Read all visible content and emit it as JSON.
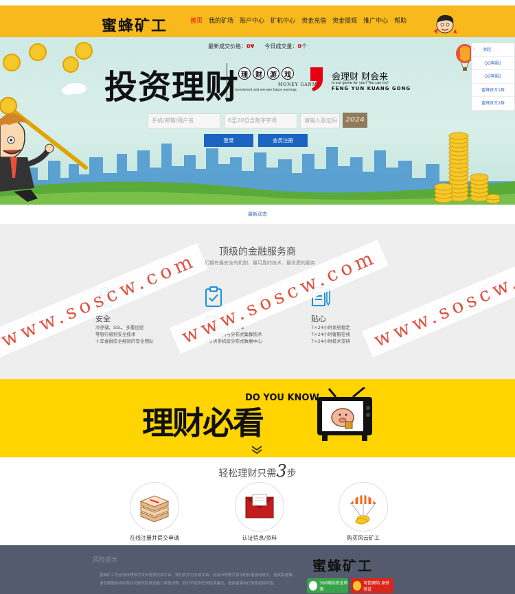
{
  "header": {
    "logo_text": "蜜蜂矿工",
    "nav": [
      "首页",
      "我的矿场",
      "账户中心",
      "矿机中心",
      "资金充值",
      "资金提现",
      "推广中心",
      "帮助"
    ],
    "colors": {
      "header_bg": "#f7b91c",
      "active_nav": "#e60012"
    }
  },
  "banner": {
    "stats": {
      "price_label": "最新成交价格：",
      "price_value": "0",
      "price_unit": "¥",
      "volume_label": "今日成交量：",
      "volume_value": "0",
      "volume_unit": "个"
    },
    "big_title": "投资理财",
    "game_chars": [
      "理",
      "财",
      "游",
      "戏"
    ],
    "money_game": "MONEY GANME",
    "game_sub": "Investment and win-win future earnings",
    "slogan": "会理财 财会来",
    "slogan_sub1": "Is our game for you? You can try!",
    "slogan_sub2": "FENG YUN KUANG GONG",
    "inputs": {
      "username_placeholder": "手机/邮箱/用户名",
      "password_placeholder": "6至20位含数字字母",
      "captcha_placeholder": "请输入验证码"
    },
    "captcha_code": "2024",
    "login_button": "登录",
    "register_button": "会员注册",
    "side_panel": [
      "收起",
      "QQ客服1",
      "QQ客服2",
      "蜜蜂官方1群",
      "蜜蜂官方2群"
    ]
  },
  "news": {
    "label": "最新动态"
  },
  "features": {
    "title": "顶级的金融服务商",
    "subtitle": "我们拥有最安全的机制、最可靠的技术、最优质的服务",
    "items": [
      {
        "icon": "lock-icon",
        "title": "安全",
        "lines": [
          "冷存储、SSL、多重加密",
          "等银行级别安全技术",
          "十年金融安全经验的安全团队"
        ]
      },
      {
        "icon": "clipboard-check-icon",
        "title": "可靠",
        "lines": [
          "专业的风控体系保障",
          "分布式架构与分布式集群技术",
          "多节点多机房分布式数据中心"
        ]
      },
      {
        "icon": "document-pen-icon",
        "title": "贴心",
        "lines": [
          "7×24小时系统稳定",
          "7×24小时客服在线",
          "7×24小时技术支持"
        ]
      }
    ],
    "watermark": "www.soscw.com"
  },
  "promo": {
    "title": "理财必看",
    "english": "DO YOU KNOW",
    "colors": {
      "bg": "#ffd400"
    }
  },
  "steps": {
    "title_prefix": "轻松理财只需",
    "title_number": "3",
    "title_suffix": "步",
    "items": [
      {
        "icon": "books-icon",
        "label": "在线注册并提交申请"
      },
      {
        "icon": "envelope-icon",
        "label": "认证信息/资料"
      },
      {
        "icon": "parachute-coin-icon",
        "label": "购买风云矿工"
      }
    ]
  },
  "footer": {
    "title": "风险提示",
    "text": "蜜蜂矿工为比特币等数字货币提供交易平台，我们仅作为交易平台，比特币等数字货币的价格波动较大，投资需谨慎，请您根据自身财务状况和风险承受能力审慎决策，我们不提供任何投资建议，投资者需自行承担投资风险。",
    "logo_text": "蜜蜂矿工",
    "badges": [
      "360网站安全检测",
      "可信网站 身份验证"
    ]
  }
}
